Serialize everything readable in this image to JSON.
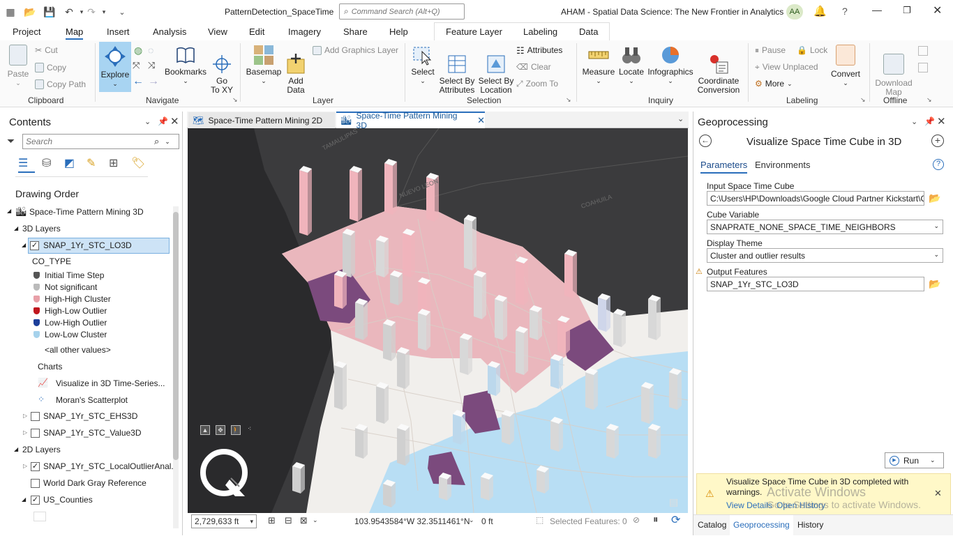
{
  "app": {
    "project_name": "PatternDetection_SpaceTime",
    "command_search_placeholder": "Command Search (Alt+Q)",
    "org_title": "AHAM - Spatial Data Science:  The New Frontier in Analytics",
    "user_initials": "AA"
  },
  "ribbon_tabs": [
    "Project",
    "Map",
    "Insert",
    "Analysis",
    "View",
    "Edit",
    "Imagery",
    "Share",
    "Help"
  ],
  "context_tabs": [
    "Feature Layer",
    "Labeling",
    "Data"
  ],
  "ribbon": {
    "clipboard": {
      "label": "Clipboard",
      "paste": "Paste",
      "cut": "Cut",
      "copy": "Copy",
      "copy_path": "Copy Path"
    },
    "navigate": {
      "label": "Navigate",
      "explore": "Explore",
      "bookmarks": "Bookmarks",
      "goto_xy": "Go\nTo XY"
    },
    "layer": {
      "label": "Layer",
      "basemap": "Basemap",
      "add_data": "Add\nData",
      "add_graphics": "Add Graphics Layer"
    },
    "selection": {
      "label": "Selection",
      "select": "Select",
      "select_by_attr": "Select By\nAttributes",
      "select_by_loc": "Select By\nLocation",
      "attributes": "Attributes",
      "clear": "Clear",
      "zoom_to": "Zoom To"
    },
    "inquiry": {
      "label": "Inquiry",
      "measure": "Measure",
      "locate": "Locate",
      "infographics": "Infographics",
      "coord_conv": "Coordinate\nConversion"
    },
    "labeling": {
      "label": "Labeling",
      "pause": "Pause",
      "lock": "Lock",
      "view_unplaced": "View Unplaced",
      "more": "More",
      "convert": "Convert"
    },
    "offline": {
      "label": "Offline",
      "download_map": "Download\nMap"
    }
  },
  "contents": {
    "title": "Contents",
    "search_placeholder": "Search",
    "drawing_order": "Drawing Order",
    "map_name": "Space-Time Pattern Mining 3D",
    "layers_3d": "3D Layers",
    "layer_selected": "SNAP_1Yr_STC_LO3D",
    "field": "CO_TYPE",
    "legend": [
      {
        "label": "Initial Time Step",
        "color": "#555555"
      },
      {
        "label": "Not significant",
        "color": "#bbbbbb"
      },
      {
        "label": "High-High Cluster",
        "color": "#e8a0a8"
      },
      {
        "label": "High-Low Outlier",
        "color": "#c0161e"
      },
      {
        "label": "Low-High Outlier",
        "color": "#1c3f9a"
      },
      {
        "label": "Low-Low Cluster",
        "color": "#a6d2ec"
      }
    ],
    "all_other": "<all other values>",
    "charts_heading": "Charts",
    "charts": [
      "Visualize in 3D Time-Series...",
      "Moran's Scatterplot"
    ],
    "other_3d": [
      "SNAP_1Yr_STC_EHS3D",
      "SNAP_1Yr_STC_Value3D"
    ],
    "layers_2d": "2D Layers",
    "layers_2d_items": [
      {
        "label": "SNAP_1Yr_STC_LocalOutlierAnal...",
        "checked": true
      },
      {
        "label": "World Dark Gray Reference",
        "checked": false
      },
      {
        "label": "US_Counties",
        "checked": true
      }
    ]
  },
  "map_tabs": [
    "Space-Time Pattern Mining 2D",
    "Space-Time Pattern Mining 3D"
  ],
  "map_labels": [
    "TAMAULIPAS",
    "NUEVO LEON",
    "COAHUILA"
  ],
  "status": {
    "scale": "2,729,633 ft",
    "coords": "103.9543584°W 32.3511461°N",
    "elevation": "0 ft",
    "selected": "Selected Features: 0"
  },
  "geoprocessing": {
    "title": "Geoprocessing",
    "tool_title": "Visualize Space Time Cube in 3D",
    "tab_params": "Parameters",
    "tab_env": "Environments",
    "input_label": "Input Space Time Cube",
    "input_value": "C:\\Users\\HP\\Downloads\\Google Cloud Partner Kickstart\\C",
    "var_label": "Cube Variable",
    "var_value": "SNAPRATE_NONE_SPACE_TIME_NEIGHBORS",
    "theme_label": "Display Theme",
    "theme_value": "Cluster and outlier results",
    "output_label": "Output Features",
    "output_value": "SNAP_1Yr_STC_LO3D",
    "run": "Run",
    "msg": "Visualize Space Time Cube in 3D completed with warnings.",
    "view_details": "View Details",
    "open_history": "Open History",
    "activate1": "Activate Windows",
    "activate2": "Go to Settings to activate Windows.",
    "bottom_tabs": [
      "Catalog",
      "Geoprocessing",
      "History"
    ]
  }
}
